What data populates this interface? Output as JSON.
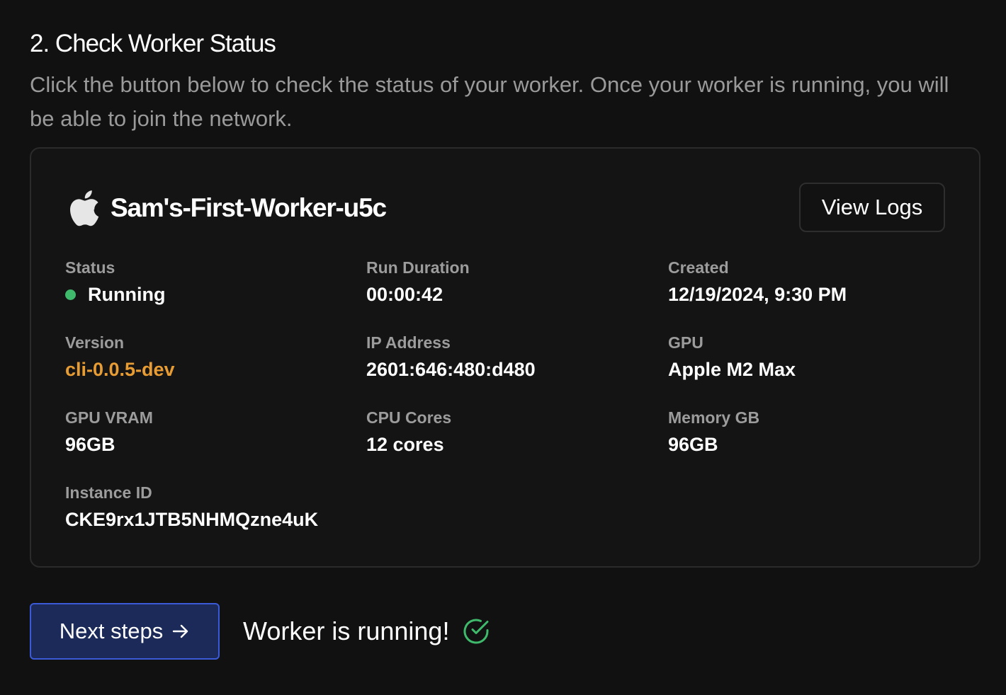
{
  "section": {
    "title": "2. Check Worker Status",
    "description": "Click the button below to check the status of your worker. Once your worker is running, you will be able to join the network."
  },
  "worker": {
    "platform_icon": "apple-icon",
    "name": "Sam's-First-Worker-u5c",
    "view_logs_label": "View Logs",
    "fields": {
      "status": {
        "label": "Status",
        "value": "Running",
        "indicator_color": "#3fb96b"
      },
      "run_duration": {
        "label": "Run Duration",
        "value": "00:00:42"
      },
      "created": {
        "label": "Created",
        "value": "12/19/2024, 9:30 PM"
      },
      "version": {
        "label": "Version",
        "value": "cli-0.0.5-dev",
        "value_color": "#e89c34"
      },
      "ip_address": {
        "label": "IP Address",
        "value": "2601:646:480:d480"
      },
      "gpu": {
        "label": "GPU",
        "value": "Apple M2 Max"
      },
      "gpu_vram": {
        "label": "GPU VRAM",
        "value": "96GB"
      },
      "cpu_cores": {
        "label": "CPU Cores",
        "value": "12 cores"
      },
      "memory_gb": {
        "label": "Memory GB",
        "value": "96GB"
      },
      "instance_id": {
        "label": "Instance ID",
        "value": "CKE9rx1JTB5NHMQzne4uK"
      }
    }
  },
  "footer": {
    "next_button_label": "Next steps",
    "next_button_icon": "arrow-right-icon",
    "running_message": "Worker is running!",
    "running_icon": "check-circle-icon",
    "accent_color": "#3a5ad8",
    "success_color": "#3fb96b"
  }
}
